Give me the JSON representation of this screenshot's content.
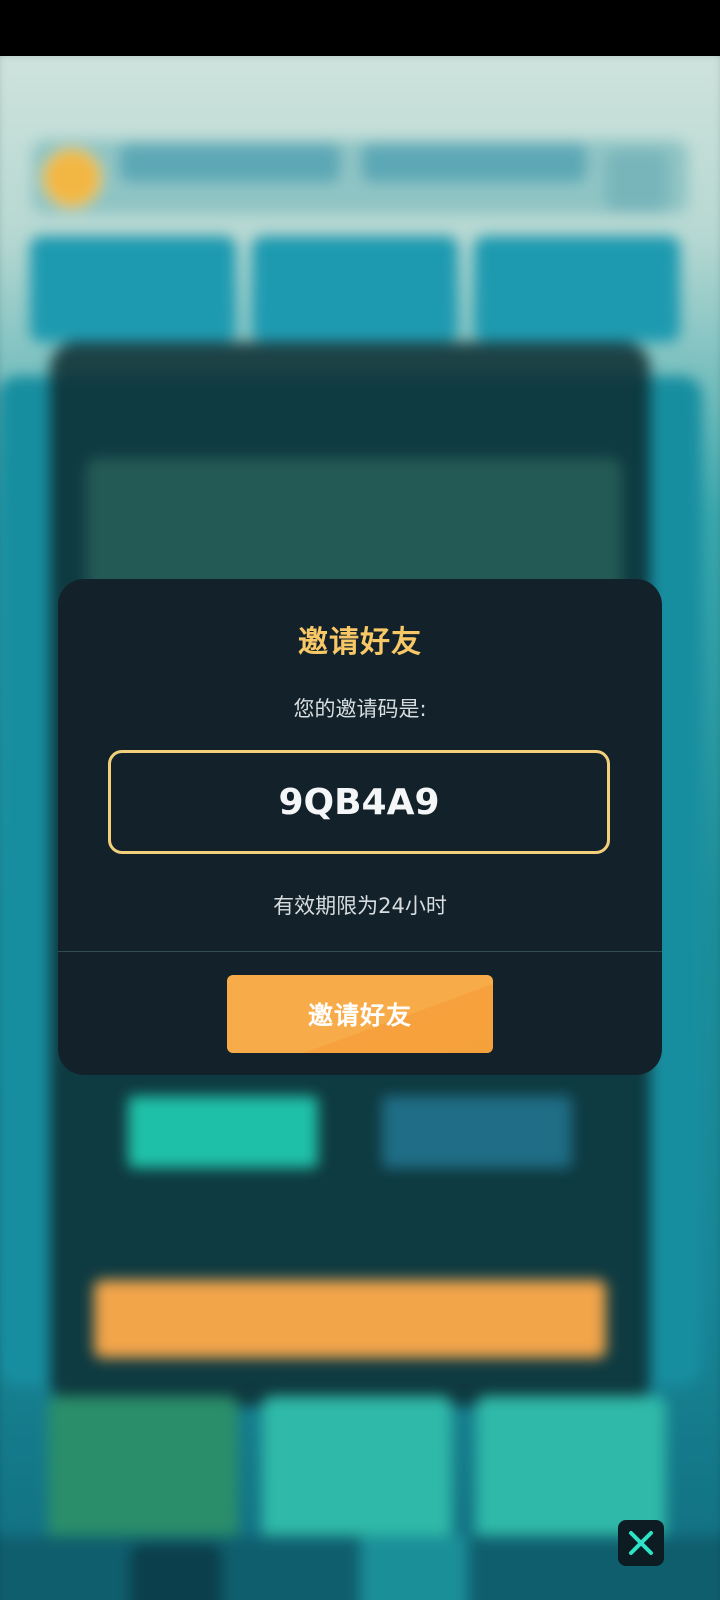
{
  "dialog": {
    "title": "邀请好友",
    "code_label": "您的邀请码是:",
    "invite_code": "9QB4A9",
    "validity": "有效期限为24小时",
    "invite_button": "邀请好友"
  },
  "colors": {
    "dialog_bg": "#13222a",
    "title": "#f8c766",
    "code_border": "#f3cf7c",
    "button": "#f8ac49"
  },
  "icons": [
    "close-icon"
  ]
}
